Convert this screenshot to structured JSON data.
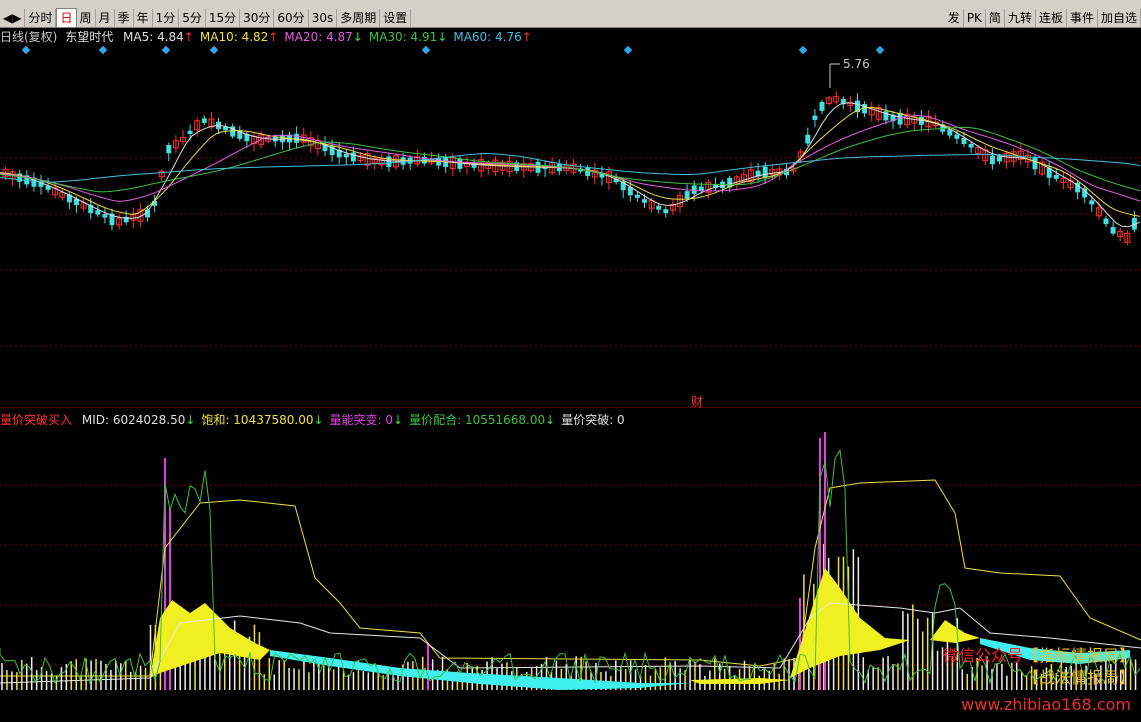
{
  "toolbar": {
    "buttons": [
      "分时",
      "日",
      "周",
      "月",
      "季",
      "年",
      "1分",
      "5分",
      "15分",
      "30分",
      "60分",
      "30s",
      "多周期",
      "设置"
    ],
    "active": "日",
    "right_buttons": [
      "发",
      "PK",
      "简",
      "九转",
      "连板",
      "事件",
      "加自选"
    ]
  },
  "main_panel": {
    "period_label": "日线(复权)",
    "stock_name": "东望时代",
    "ma": [
      {
        "label": "MA5:",
        "value": "4.84",
        "arrow": "↑",
        "color": "#e0e0e0"
      },
      {
        "label": "MA10:",
        "value": "4.82",
        "arrow": "↑",
        "color": "#f0e040"
      },
      {
        "label": "MA20:",
        "value": "4.87",
        "arrow": "↓",
        "color": "#e060e0"
      },
      {
        "label": "MA30:",
        "value": "4.91",
        "arrow": "↓",
        "color": "#40c040"
      },
      {
        "label": "MA60:",
        "value": "4.76",
        "arrow": "↑",
        "color": "#40c0e0"
      }
    ],
    "high_label": "5.76",
    "event_marker": "财"
  },
  "indicator_panel": {
    "name": "量价突破买入",
    "fields": [
      {
        "label": "MID:",
        "value": "6024028.50",
        "arrow": "↓",
        "color": "#e0e0e0"
      },
      {
        "label": "饱和:",
        "value": "10437580.00",
        "arrow": "↓",
        "color": "#f0e040"
      },
      {
        "label": "量能突变:",
        "value": "0",
        "arrow": "↓",
        "color": "#e040e0"
      },
      {
        "label": "量价配合:",
        "value": "10551668.00",
        "arrow": "↓",
        "color": "#40c040"
      },
      {
        "label": "量价突破:",
        "value": "0",
        "arrow": "",
        "color": "#e0e0e0"
      }
    ]
  },
  "watermark": {
    "line1a": "微信公众号",
    "line1b": "【指标情报局】",
    "line2": "【战法情报局】",
    "line3": "www.zhibiao168.com"
  },
  "colors": {
    "up": "#ff3030",
    "down": "#40e0e0",
    "ma5": "#e0e0e0",
    "ma10": "#f0e040",
    "ma20": "#e060e0",
    "ma30": "#40c040",
    "ma60": "#40c0e0",
    "grid": "#800000"
  }
}
